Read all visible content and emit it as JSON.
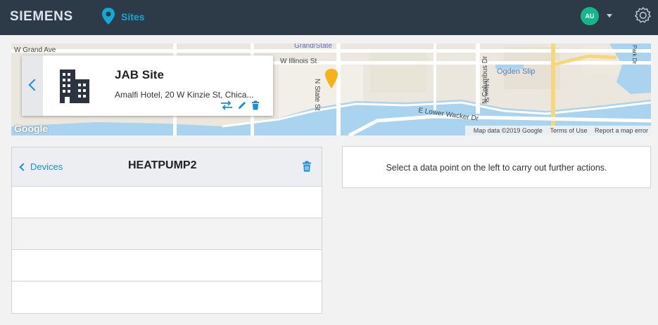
{
  "header": {
    "brand": "SIEMENS",
    "nav_label": "Sites",
    "nav_icon": "map-pin-icon",
    "avatar_initials": "AU",
    "colors": {
      "bar": "#2d3a48",
      "accent": "#12a9d6",
      "avatar": "#16b58d"
    }
  },
  "map": {
    "labels": {
      "grand_ave": "W Grand Ave",
      "grand_state": "Grand/State",
      "illinois": "W Illinois St",
      "state_st": "N State St",
      "ogden": "Ogden Slip",
      "columbus": "N Columbus Dr",
      "wacker": "E Lower Wacker Dr",
      "park": "Park Dr",
      "new_st": "N New St"
    },
    "google": "Google",
    "attribution": "Map data ©2019 Google",
    "terms": "Terms of Use",
    "report": "Report a map error"
  },
  "site_card": {
    "name": "JAB Site",
    "address": "Amalfi Hotel, 20 W Kinzie St, Chica...",
    "icons": [
      "building-icon",
      "swap-icon",
      "edit-icon",
      "trash-icon"
    ]
  },
  "devices_panel": {
    "back_label": "Devices",
    "title": "HEATPUMP2",
    "rows": [
      "",
      "",
      "",
      ""
    ]
  },
  "info_panel": {
    "message": "Select a data point on the left to carry out further actions."
  }
}
